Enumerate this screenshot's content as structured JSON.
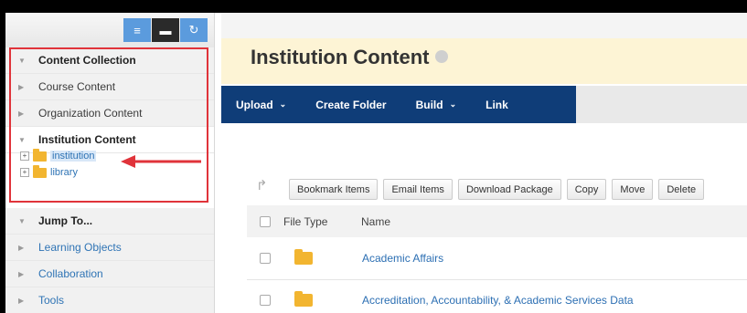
{
  "sidebar": {
    "toolbar": {
      "list_icon": "list-icon",
      "folder_icon": "folder-icon",
      "refresh_icon": "refresh-icon"
    },
    "sections": [
      {
        "label": "Content Collection",
        "expanded": true
      },
      {
        "label": "Course Content"
      },
      {
        "label": "Organization Content"
      },
      {
        "label": "Institution Content",
        "expanded": true
      },
      {
        "label": "Jump To...",
        "expanded": true
      },
      {
        "label": "Learning Objects"
      },
      {
        "label": "Collaboration"
      },
      {
        "label": "Tools"
      }
    ],
    "tree": [
      {
        "label": "institution",
        "selected": true
      },
      {
        "label": "library"
      }
    ],
    "highlight_color": "#e0333a"
  },
  "main": {
    "title": "Institution Content",
    "actions": [
      {
        "label": "Upload",
        "has_menu": true
      },
      {
        "label": "Create Folder",
        "has_menu": false
      },
      {
        "label": "Build",
        "has_menu": true
      },
      {
        "label": "Link",
        "has_menu": false
      }
    ],
    "buttons": [
      "Bookmark Items",
      "Email Items",
      "Download Package",
      "Copy",
      "Move",
      "Delete"
    ],
    "table": {
      "columns": [
        "File Type",
        "Name"
      ],
      "rows": [
        {
          "name": "Academic Affairs"
        },
        {
          "name": "Accreditation, Accountability, & Academic Services Data"
        }
      ]
    },
    "action_bar_color": "#0f3d78",
    "title_bar_color": "#fdf4d5"
  }
}
